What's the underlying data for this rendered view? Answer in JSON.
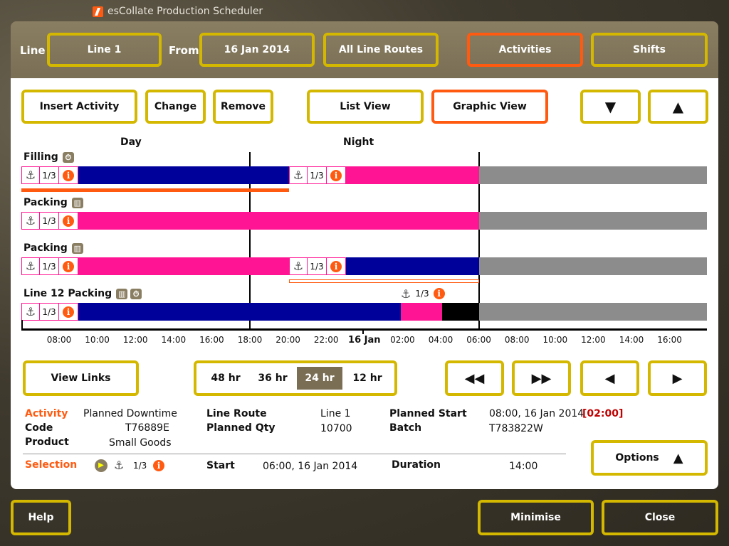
{
  "app": {
    "title": "esCollate Production Scheduler"
  },
  "topbar": {
    "line_label": "Line",
    "line_value": "Line 1",
    "from_label": "From",
    "from_value": "16 Jan 2014",
    "routes": "All Line Routes",
    "activities": "Activities",
    "shifts": "Shifts"
  },
  "toolbar": {
    "insert": "Insert Activity",
    "change": "Change",
    "remove": "Remove",
    "list_view": "List View",
    "graphic_view": "Graphic View",
    "down": "▼",
    "up": "▲"
  },
  "shifts": {
    "day": "Day",
    "night": "Night"
  },
  "rows": [
    {
      "label": "Filling",
      "icon": "timer-icon"
    },
    {
      "label": "Packing",
      "icon": "chart-icon"
    },
    {
      "label": "Packing",
      "icon": "chart-icon"
    },
    {
      "label": "Line 12 Packing",
      "icon": "chart-timer-icon"
    }
  ],
  "segment": {
    "fraction": "1/3",
    "anchor": "⚓",
    "info": "i"
  },
  "axis": {
    "ticks": [
      "08:00",
      "10:00",
      "12:00",
      "14:00",
      "16:00",
      "18:00",
      "20:00",
      "22:00",
      "16 Jan",
      "02:00",
      "04:00",
      "06:00",
      "08:00",
      "10:00",
      "12:00",
      "14:00",
      "16:00"
    ]
  },
  "zoom": {
    "view_links": "View Links",
    "h48": "48 hr",
    "h36": "36 hr",
    "h24": "24 hr",
    "h12": "12 hr",
    "rewind": "◀◀",
    "forward": "▶▶",
    "back": "◀",
    "next": "▶"
  },
  "details": {
    "activity_label": "Activity",
    "activity_value": "Planned Downtime",
    "code_label": "Code",
    "code_value": "T76889E",
    "product_label": "Product",
    "product_value": "Small Goods",
    "route_label": "Line Route",
    "route_value": "Line 1",
    "qty_label": "Planned Qty",
    "qty_value": "10700",
    "pstart_label": "Planned Start",
    "pstart_value": "08:00, 16 Jan 2014",
    "pstart_delta": "[02:00]",
    "batch_label": "Batch",
    "batch_value": "T783822W",
    "selection_label": "Selection",
    "sel_fraction": "1/3",
    "start_label": "Start",
    "start_value": "06:00, 16 Jan 2014",
    "duration_label": "Duration",
    "duration_value": "14:00",
    "options": "Options",
    "options_arrow": "▲"
  },
  "footer": {
    "help": "Help",
    "minimise": "Minimise",
    "close": "Close"
  },
  "colors": {
    "accent": "#ff5a10",
    "button_border": "#d4b800",
    "navy": "#00009a",
    "pink": "#ff1493",
    "grey": "#8c8c8c"
  }
}
